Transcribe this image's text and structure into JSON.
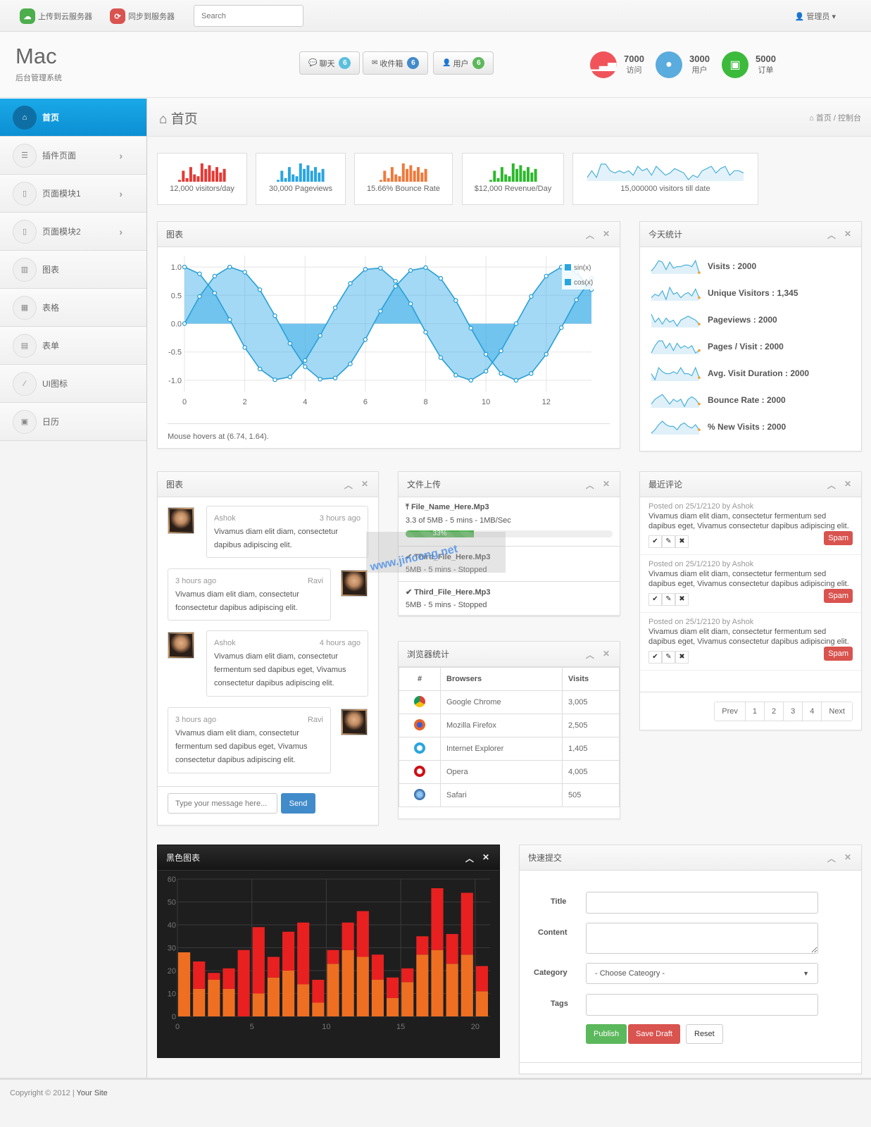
{
  "topbar": {
    "upload_label": "上传到云服务器",
    "sync_label": "同步到服务器",
    "search_placeholder": "Search",
    "admin_label": "管理员"
  },
  "header": {
    "brand": "Mac",
    "subtitle": "后台管理系统",
    "buttons": [
      {
        "label": "聊天",
        "count": "6",
        "icon": "comments-icon",
        "color": "#5bc0de"
      },
      {
        "label": "收件箱",
        "count": "6",
        "icon": "envelope-icon",
        "color": "#428bca"
      },
      {
        "label": "用户",
        "count": "6",
        "icon": "user-icon",
        "color": "#5cb85c"
      }
    ],
    "stats": [
      {
        "value": "7000",
        "label": "访问",
        "icon": "signal-icon",
        "color": "#f0545a"
      },
      {
        "value": "3000",
        "label": "用户",
        "icon": "user-icon",
        "color": "#5aabde"
      },
      {
        "value": "5000",
        "label": "订单",
        "icon": "money-icon",
        "color": "#3cba3c"
      }
    ]
  },
  "sidebar": {
    "items": [
      {
        "label": "首页",
        "icon": "home-icon",
        "active": true,
        "chevron": false
      },
      {
        "label": "插件页面",
        "icon": "list-icon",
        "active": false,
        "chevron": true
      },
      {
        "label": "页面模块1",
        "icon": "file-icon",
        "active": false,
        "chevron": true
      },
      {
        "label": "页面模块2",
        "icon": "file-icon",
        "active": false,
        "chevron": true
      },
      {
        "label": "图表",
        "icon": "bar-chart-icon",
        "active": false,
        "chevron": false
      },
      {
        "label": "表格",
        "icon": "table-icon",
        "active": false,
        "chevron": false
      },
      {
        "label": "表单",
        "icon": "form-icon",
        "active": false,
        "chevron": false
      },
      {
        "label": "UI图标",
        "icon": "magic-wand-icon",
        "active": false,
        "chevron": false
      },
      {
        "label": "日历",
        "icon": "calendar-icon",
        "active": false,
        "chevron": false
      }
    ]
  },
  "page": {
    "title": "首页",
    "breadcrumb": [
      "首页",
      "控制台"
    ]
  },
  "mini_stats": [
    {
      "label": "12,000 visitors/day",
      "color": "#e53935",
      "values": [
        1,
        6,
        2,
        8,
        4,
        3,
        10,
        7,
        9,
        6,
        8,
        5,
        7
      ]
    },
    {
      "label": "30,000 Pageviews",
      "color": "#2aa5e0",
      "values": [
        1,
        6,
        2,
        8,
        4,
        3,
        10,
        7,
        9,
        6,
        8,
        5,
        7
      ]
    },
    {
      "label": "15.66% Bounce Rate",
      "color": "#f07a3c",
      "values": [
        1,
        6,
        2,
        8,
        4,
        3,
        10,
        7,
        9,
        6,
        8,
        5,
        7
      ]
    },
    {
      "label": "$12,000 Revenue/Day",
      "color": "#2db82d",
      "values": [
        1,
        6,
        2,
        8,
        4,
        3,
        10,
        7,
        9,
        6,
        8,
        5,
        7
      ]
    }
  ],
  "mini_line": {
    "label": "15,000000 visitors till date",
    "values": [
      3,
      6,
      3,
      9,
      9,
      6,
      5,
      6,
      5,
      6,
      4,
      8,
      6,
      7,
      4,
      8,
      6,
      4,
      5,
      7,
      6,
      5,
      2,
      4,
      3,
      6,
      7,
      8,
      5,
      7,
      8,
      4,
      6,
      6,
      5
    ]
  },
  "chart_data": [
    {
      "type": "line",
      "title": "图表",
      "series": [
        {
          "name": "sin(x)",
          "x": [
            0,
            0.5,
            1,
            1.5,
            2,
            2.5,
            3,
            3.5,
            4,
            4.5,
            5,
            5.5,
            6,
            6.5,
            7,
            7.5,
            8,
            8.5,
            9,
            9.5,
            10,
            10.5,
            11,
            11.5,
            12,
            12.5,
            13,
            13.5
          ],
          "values": [
            0,
            0.48,
            0.84,
            1.0,
            0.91,
            0.6,
            0.14,
            -0.35,
            -0.76,
            -0.98,
            -0.96,
            -0.71,
            -0.28,
            0.22,
            0.66,
            0.94,
            0.99,
            0.8,
            0.41,
            -0.08,
            -0.54,
            -0.88,
            -1.0,
            -0.88,
            -0.54,
            -0.07,
            0.42,
            0.8
          ]
        },
        {
          "name": "cos(x)",
          "x": [
            0,
            0.5,
            1,
            1.5,
            2,
            2.5,
            3,
            3.5,
            4,
            4.5,
            5,
            5.5,
            6,
            6.5,
            7,
            7.5,
            8,
            8.5,
            9,
            9.5,
            10,
            10.5,
            11,
            11.5,
            12,
            12.5,
            13,
            13.5
          ],
          "values": [
            1.0,
            0.88,
            0.54,
            0.07,
            -0.42,
            -0.8,
            -0.99,
            -0.94,
            -0.65,
            -0.21,
            0.28,
            0.71,
            0.96,
            0.98,
            0.75,
            0.35,
            -0.15,
            -0.6,
            -0.91,
            -1.0,
            -0.84,
            -0.48,
            0.0,
            0.48,
            0.84,
            1.0,
            0.91,
            0.6
          ]
        }
      ],
      "xticks": [
        "0",
        "2",
        "4",
        "6",
        "8",
        "10",
        "12"
      ],
      "yticks": [
        "1.0",
        "0.5",
        "0.0",
        "-0.5",
        "-1.0"
      ],
      "xlim": [
        0,
        13.5
      ],
      "ylim": [
        -1.2,
        1.2
      ],
      "legend": "top-right",
      "grid": true,
      "hover_text": "Mouse hovers at (6.74, 1.64)."
    },
    {
      "type": "bar",
      "title": "黑色图表",
      "stacked": true,
      "categories": [
        0,
        1,
        2,
        3,
        4,
        5,
        6,
        7,
        8,
        9,
        10,
        11,
        12,
        13,
        14,
        15,
        16,
        17,
        18,
        19,
        20
      ],
      "series": [
        {
          "name": "series1",
          "color": "#ee6f22",
          "values": [
            28,
            12,
            16,
            12,
            0,
            10,
            17,
            20,
            14,
            6,
            23,
            29,
            26,
            16,
            8,
            15,
            27,
            29,
            23,
            27,
            11
          ]
        },
        {
          "name": "series2",
          "color": "#e82020",
          "values": [
            0,
            12,
            3,
            9,
            29,
            29,
            9,
            17,
            27,
            10,
            6,
            12,
            20,
            11,
            9,
            6,
            8,
            27,
            13,
            27,
            11
          ]
        }
      ],
      "xticks": [
        "0",
        "5",
        "10",
        "15",
        "20"
      ],
      "yticks": [
        "60",
        "50",
        "40",
        "30",
        "20",
        "10",
        "0"
      ],
      "ylim": [
        0,
        60
      ],
      "grid": true
    }
  ],
  "chart_box": {
    "title": "图表"
  },
  "today": {
    "title": "今天统计",
    "items": [
      {
        "label": "Visits : 2000",
        "values": [
          2,
          5,
          9,
          8,
          3,
          8,
          4,
          5,
          5,
          6,
          6,
          5,
          9,
          1
        ]
      },
      {
        "label": "Unique Visitors : 1,345",
        "values": [
          3,
          5,
          4,
          7,
          2,
          9,
          5,
          6,
          3,
          5,
          6,
          4,
          8,
          3
        ]
      },
      {
        "label": "Pageviews : 2000",
        "values": [
          8,
          4,
          6,
          3,
          6,
          4,
          5,
          2,
          5,
          6,
          7,
          6,
          5,
          3
        ]
      },
      {
        "label": "Pages / Visit : 2000",
        "values": [
          3,
          6,
          8,
          8,
          5,
          7,
          4,
          7,
          5,
          6,
          5,
          6,
          3,
          4
        ]
      },
      {
        "label": "Avg. Visit Duration : 2000",
        "values": [
          5,
          2,
          8,
          6,
          5,
          5,
          6,
          5,
          8,
          5,
          5,
          4,
          8,
          3
        ]
      },
      {
        "label": "Bounce Rate : 2000",
        "values": [
          3,
          5,
          6,
          7,
          5,
          3,
          5,
          4,
          5,
          2,
          5,
          6,
          5,
          3
        ]
      },
      {
        "label": "% New Visits : 2000",
        "values": [
          1,
          3,
          6,
          8,
          6,
          5,
          5,
          3,
          6,
          7,
          5,
          4,
          6,
          3
        ]
      }
    ]
  },
  "chat": {
    "title": "图表",
    "messages": [
      {
        "name": "Ashok",
        "time": "3 hours ago",
        "text": "Vivamus diam elit diam, consectetur dapibus adipiscing elit.",
        "side": "left"
      },
      {
        "name": "Ravi",
        "time": "3 hours ago",
        "text": "Vivamus diam elit diam, consectetur fconsectetur dapibus adipiscing elit.",
        "side": "right"
      },
      {
        "name": "Ashok",
        "time": "4 hours ago",
        "text": "Vivamus diam elit diam, consectetur fermentum sed dapibus eget, Vivamus consectetur dapibus adipiscing elit.",
        "side": "left"
      },
      {
        "name": "Ravi",
        "time": "3 hours ago",
        "text": "Vivamus diam elit diam, consectetur fermentum sed dapibus eget, Vivamus consectetur dapibus adipiscing elit.",
        "side": "right"
      }
    ],
    "input_placeholder": "Type your message here...",
    "send_label": "Send"
  },
  "upload": {
    "title": "文件上传",
    "files": [
      {
        "name": "File_Name_Here.Mp3",
        "info": "3.3 of 5MB - 5 mins - 1MB/Sec",
        "progress": 33,
        "progress_label": "33%",
        "icon": "upload-icon"
      },
      {
        "name": "Third_File_Here.Mp3",
        "info": "5MB - 5 mins - Stopped",
        "icon": "check-icon"
      },
      {
        "name": "Third_File_Here.Mp3",
        "info": "5MB - 5 mins - Stopped",
        "icon": "check-icon"
      }
    ]
  },
  "browsers": {
    "title": "浏览器统计",
    "headers": [
      "#",
      "Browsers",
      "Visits"
    ],
    "rows": [
      {
        "icon": "chrome-icon",
        "name": "Google Chrome",
        "visits": "3,005"
      },
      {
        "icon": "firefox-icon",
        "name": "Mozilla Firefox",
        "visits": "2,505"
      },
      {
        "icon": "ie-icon",
        "name": "Internet Explorer",
        "visits": "1,405"
      },
      {
        "icon": "opera-icon",
        "name": "Opera",
        "visits": "4,005"
      },
      {
        "icon": "safari-icon",
        "name": "Safari",
        "visits": "505"
      }
    ]
  },
  "comments": {
    "title": "最近评论",
    "items": [
      {
        "meta": "Posted on 25/1/2120 by Ashok",
        "text": "Vivamus diam elit diam, consectetur fermentum sed dapibus eget, Vivamus consectetur dapibus adipiscing elit.",
        "spam_label": "Spam"
      },
      {
        "meta": "Posted on 25/1/2120 by Ashok",
        "text": "Vivamus diam elit diam, consectetur fermentum sed dapibus eget, Vivamus consectetur dapibus adipiscing elit.",
        "spam_label": "Spam"
      },
      {
        "meta": "Posted on 25/1/2120 by Ashok",
        "text": "Vivamus diam elit diam, consectetur fermentum sed dapibus eget, Vivamus consectetur dapibus adipiscing elit.",
        "spam_label": "Spam"
      }
    ],
    "pager": [
      "Prev",
      "1",
      "2",
      "3",
      "4",
      "Next"
    ]
  },
  "dark_chart": {
    "title": "黑色图表"
  },
  "quick": {
    "title": "快速提交",
    "labels": {
      "title": "Title",
      "content": "Content",
      "category": "Category",
      "tags": "Tags"
    },
    "values": {
      "title": "",
      "content": "",
      "tags": ""
    },
    "category_selected": "- Choose Cateogry -",
    "publish": "Publish",
    "save_draft": "Save Draft",
    "reset": "Reset"
  },
  "footer": {
    "copyright": "Copyright © 2012 |",
    "site": "Your Site"
  },
  "watermark": "www.jincong.net"
}
